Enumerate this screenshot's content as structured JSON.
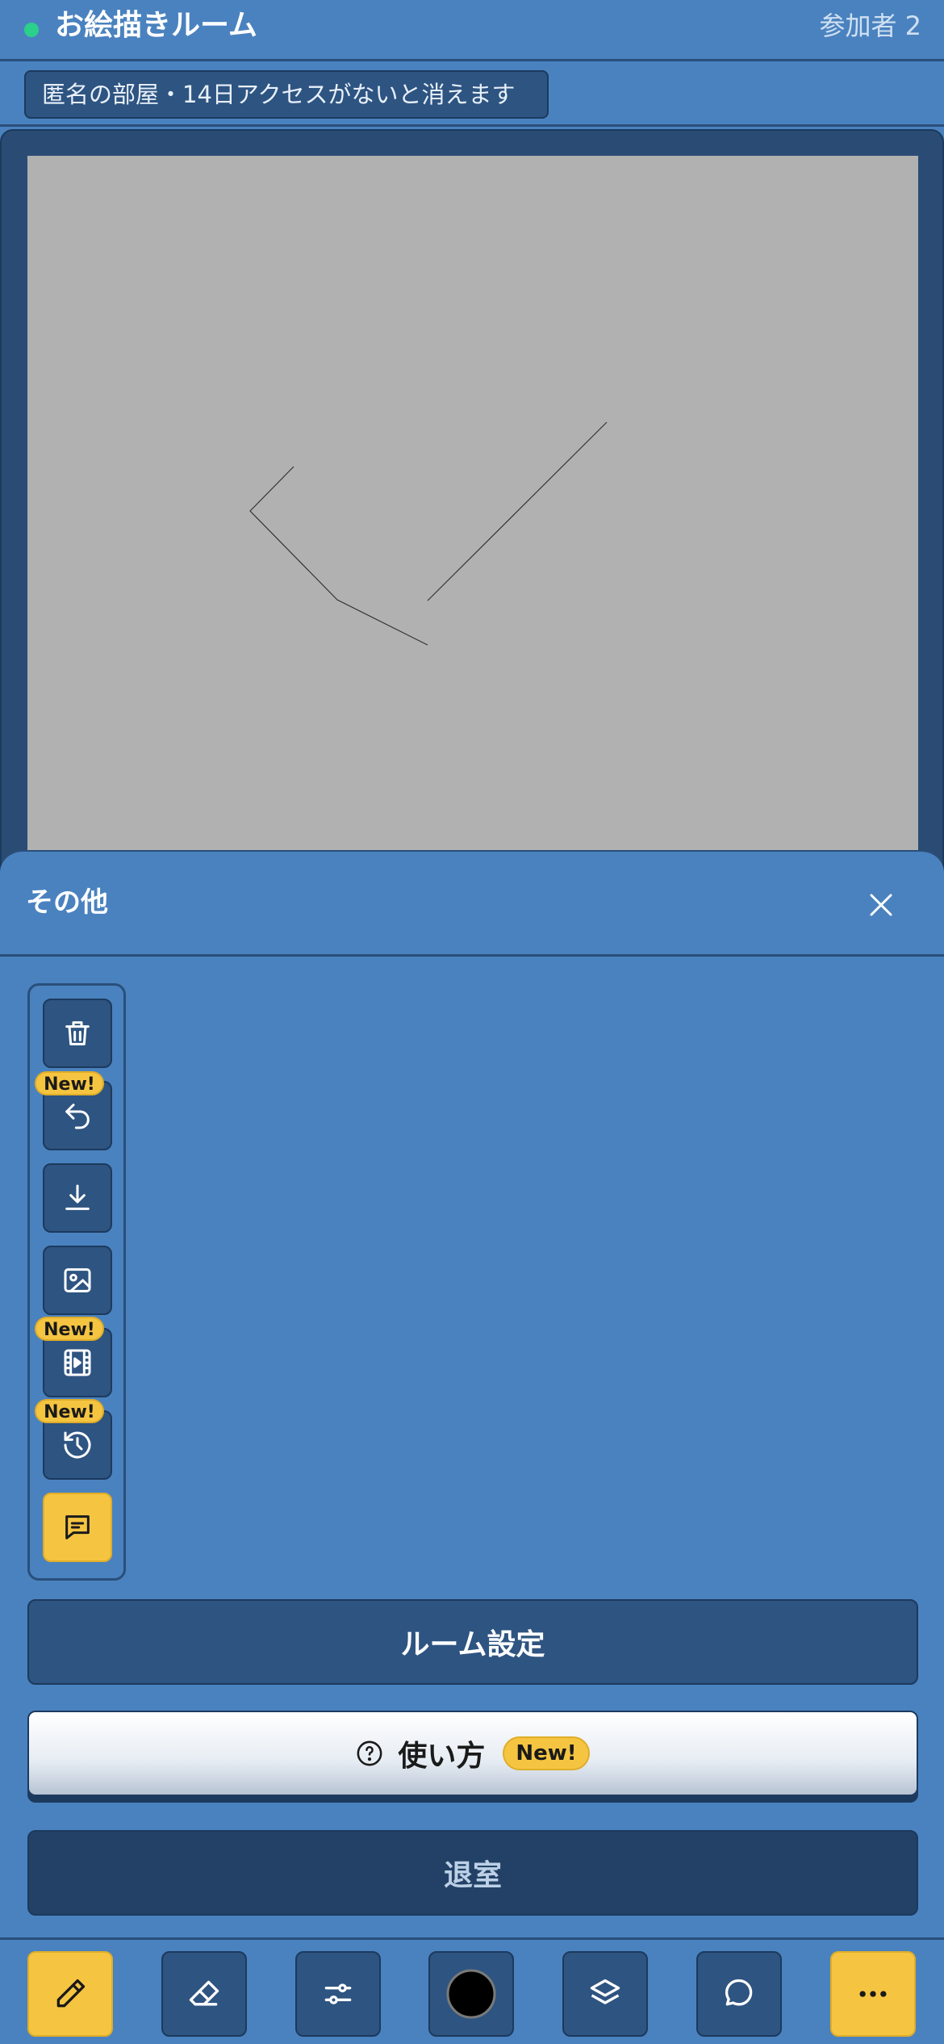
{
  "header": {
    "title": "お絵描きルーム",
    "participants": "参加者 2"
  },
  "notice": "匿名の部屋・14日アクセスがないと消えます",
  "sheet": {
    "title": "その他",
    "tools": [
      {
        "icon": "trash-icon",
        "badge": ""
      },
      {
        "icon": "undo-icon",
        "badge": "New!"
      },
      {
        "icon": "download-icon",
        "badge": ""
      },
      {
        "icon": "image-icon",
        "badge": ""
      },
      {
        "icon": "film-icon",
        "badge": "New!"
      },
      {
        "icon": "history-icon",
        "badge": "New!"
      },
      {
        "icon": "chat-icon",
        "badge": ""
      }
    ],
    "room_settings_label": "ルーム設定",
    "howto_label": "使い方",
    "howto_badge": "New!",
    "exit_label": "退室"
  },
  "bottom_bar": [
    "pen-icon",
    "eraser-icon",
    "sliders-icon",
    "color-icon",
    "layers-icon",
    "chat-bubble-icon",
    "more-icon"
  ],
  "colors": {
    "accent": "#f5c542",
    "background": "#4a82bf",
    "dark": "#2e5481",
    "canvas": "#b1b1b1",
    "status": "#2bd08a"
  }
}
